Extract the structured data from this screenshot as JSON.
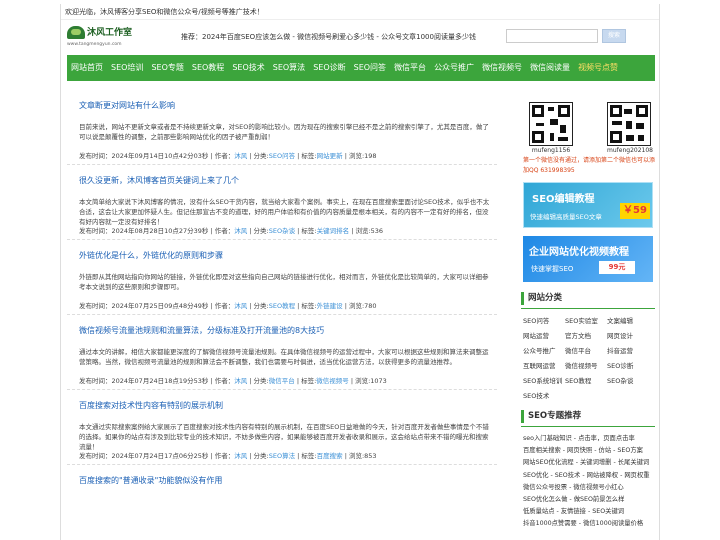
{
  "welcome": "欢迎光临，沐风博客分享SEO和微信公众号/视频号等推广技术！",
  "logo": {
    "name": "沐风工作室",
    "url": "www.tangmengyun.com"
  },
  "promo": "推荐：2024年百度SEO应该怎么做 - 微信视频号刷爱心多少钱 - 公众号文章1000阅读量多少钱",
  "search": {
    "placeholder": "",
    "button": "搜索"
  },
  "nav": [
    "网站首页",
    "SEO培训",
    "SEO专题",
    "SEO教程",
    "SEO技术",
    "SEO算法",
    "SEO诊断",
    "SEO问答",
    "微信平台",
    "公众号推广",
    "微信视频号",
    "微信阅读量",
    "视频号点赞"
  ],
  "nav_active_index": 12,
  "articles": [
    {
      "title": "文章断更对网站有什么影响",
      "summary": "目前来说，网站不更新文章或者是不持续更新文章，对SEO的影响比较小。因为现在的搜索引擎已经不是之前的搜索引擎了，尤其是百度，做了可以说是颠覆性的调整，之前那些影响网站优化的因子被严重削弱！",
      "date": "发布时间：2024年09月14日10点42分03秒",
      "author_label": " | 作者：",
      "author": "沐风",
      "category_label": " | 分类:",
      "category": "SEO问答",
      "tag_label": " | 标签:",
      "tag": "网站更新",
      "views": " | 浏览:198"
    },
    {
      "title": "很久没更新，沐风博客首页关键词上来了几个",
      "summary": "本文简单给大家说下沐风博客的情况，没有什么SEO干货内容，就当给大家看个案例。事实上，在现在百度搜索里面讨论SEO技术，似乎也不太合适，这会让大家更加怀疑人生。但记住那宣古不变的道理，好的用户体验和有价值的内容质量是根本相关，有的内容不一定有好的排名，但没有好内容就一定没有好排名！",
      "date": "发布时间：2024年08月28日10点27分39秒",
      "author_label": " | 作者：",
      "author": "沐风",
      "category_label": " | 分类:",
      "category": "SEO杂谈",
      "tag_label": " | 标签:",
      "tag": "关键词排名",
      "views": " | 浏览:536"
    },
    {
      "title": "外链优化是什么，外链优化的原则和步骤",
      "summary": "外链即从其他网站指向你网站的链接，外链优化即是对这些指向自己网站的链接进行优化，相对而言，外链优化是比较简单的，大家可以详细参考本文说到的这些原则和步骤即可。",
      "date": "发布时间：2024年07月25日09点48分49秒",
      "author_label": " | 作者：",
      "author": "沐风",
      "category_label": " | 分类:",
      "category": "SEO教程",
      "tag_label": " | 标签:",
      "tag": "外链建设",
      "views": " | 浏览:780"
    },
    {
      "title": "微信视频号流量池规则和流量算法，分级标准及打开流量池的8大技巧",
      "summary": "通过本文的讲解，相信大家都能更深度的了解微信视频号流量池规则。在具体微信视频号的运营过程中，大家可以根据这些规则和算法来调整运营策略。当然，微信视频号流量池的规则和算法会不断调整，我们也需要与时俱进，适当优化运营方法，以获得更多的流量池推荐。",
      "date": "发布时间：2024年07月24日18点19分53秒",
      "author_label": " | 作者：",
      "author": "沐风",
      "category_label": " | 分类:",
      "category": "微信平台",
      "tag_label": " | 标签:",
      "tag": "微信视频号",
      "views": " | 浏览:1073"
    },
    {
      "title": "百度搜索对技术性内容有特别的展示机制",
      "summary": "本文通过实际搜索案例给大家展示了百度搜索对技术性内容有特别的展示机制，在百度SEO日益难做的今天，针对百度开发者做些事情是个不错的选择。如果你的站点有涉及到比较专业的技术知识，不妨多做些内容，如果能够被百度开发者收录和展示，这会给站点带来不错的曝光和搜索流量！",
      "date": "发布时间：2024年07月24日17点06分25秒",
      "author_label": " | 作者：",
      "author": "沐风",
      "category_label": " | 分类:",
      "category": "SEO算法",
      "tag_label": " | 标签:",
      "tag": "百度搜索",
      "views": " | 浏览:853"
    },
    {
      "title": "百度搜索的\"普通收录\"功能貌似没有作用",
      "summary": "",
      "date": "",
      "author_label": "",
      "author": "",
      "category_label": "",
      "category": "",
      "tag_label": "",
      "tag": "",
      "views": ""
    }
  ],
  "qr": [
    {
      "label": "mufeng1156"
    },
    {
      "label": "mufeng202108"
    }
  ],
  "qr_tip": "第一个微信没有通过，请添加第二个微信也可以添加QQ 631998395",
  "banner1": {
    "title": "SEO编辑教程",
    "subtitle": "快速编辑高质量SEO文章",
    "price": "￥59"
  },
  "banner2": {
    "title": "企业网站优化视频教程",
    "subtitle": "快速掌握SEO",
    "price": "99元"
  },
  "categories": {
    "title": "网站分类",
    "items": [
      "SEO问答",
      "SEO实验室",
      "文案编辑",
      "网站运营",
      "官方文档",
      "网页设计",
      "公众号推广",
      "微信平台",
      "抖音运营",
      "互联网运营",
      "微信视频号",
      "SEO诊断",
      "SEO系统培训",
      "SEO教程",
      "SEO杂谈",
      "SEO技术"
    ]
  },
  "topics": {
    "title": "SEO专题推荐",
    "items": [
      "seo入门基础知识 - 点击率，页面点击率",
      "百度相关搜索 - 网页快照 - 仿站 - SEO方案",
      "网站SEO优化流程 - 关键词增删 - 长尾关键词",
      "SEO优化 - SEO技术 - 网站被降权 - 网页权重",
      "微信公众号投票 - 微信视频号小红心",
      "SEO优化怎么做 - 做SEO前景怎么样",
      "低质量站点 - 友情链接 - SEO关键词",
      "抖音1000点赞需要 - 微信1000阅读量价格"
    ]
  }
}
